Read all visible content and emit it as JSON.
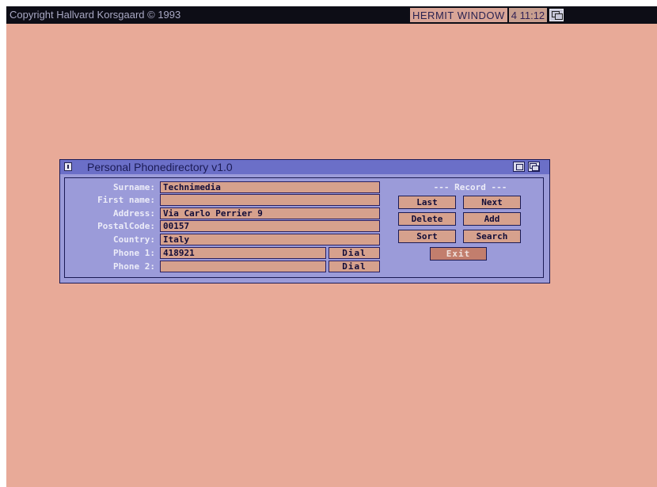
{
  "screen": {
    "title": "Copyright Hallvard Korsgaard © 1993",
    "right_label": "HERMIT WINDOW",
    "memory_display": "4 11:12"
  },
  "window": {
    "title": "Personal Phonedirectory  v1.0"
  },
  "form": {
    "surname_label": "Surname:",
    "surname_value": "Technimedia",
    "firstname_label": "First name:",
    "firstname_value": "",
    "address_label": "Address:",
    "address_value": "Via Carlo Perrier 9",
    "postalcode_label": "PostalCode:",
    "postalcode_value": "00157",
    "country_label": "Country:",
    "country_value": "Italy",
    "phone1_label": "Phone 1:",
    "phone1_value": "418921",
    "phone2_label": "Phone 2:",
    "phone2_value": "",
    "dial_label": "Dial"
  },
  "record": {
    "header": "--- Record ---",
    "last": "Last",
    "next": "Next",
    "delete": "Delete",
    "add": "Add",
    "sort": "Sort",
    "search": "Search",
    "exit": "Exit"
  }
}
